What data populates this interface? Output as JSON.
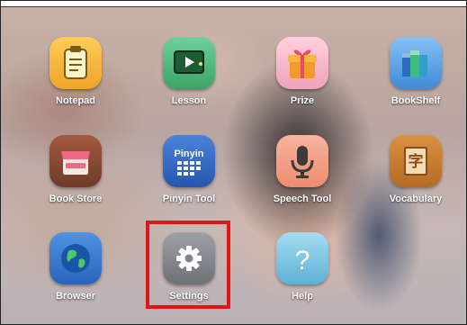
{
  "apps": [
    {
      "key": "notepad",
      "label": "Notepad",
      "icon": "notepad-icon",
      "color": "#f2b43a"
    },
    {
      "key": "lesson",
      "label": "Lesson",
      "icon": "lesson-board-icon",
      "color": "#4caf7a"
    },
    {
      "key": "prize",
      "label": "Prize",
      "icon": "gift-icon",
      "color": "#f4b3c6"
    },
    {
      "key": "bookshelf",
      "label": "BookShelf",
      "icon": "books-icon",
      "color": "#5ea3e6"
    },
    {
      "key": "bookstore",
      "label": "Book Store",
      "icon": "store-icon",
      "color": "#8a4b35"
    },
    {
      "key": "pinyin",
      "label": "Pinyin Tool",
      "icon": "keyboard-icon",
      "color": "#3a6cc8",
      "icon_text": "Pinyin"
    },
    {
      "key": "speech",
      "label": "Speech Tool",
      "icon": "microphone-icon",
      "color": "#f2a489"
    },
    {
      "key": "vocabulary",
      "label": "Vocabulary",
      "icon": "dictionary-icon",
      "color": "#c97c2c",
      "icon_text": "字"
    },
    {
      "key": "browser",
      "label": "Browser",
      "icon": "globe-icon",
      "color": "#3f7fd1"
    },
    {
      "key": "settings",
      "label": "Settings",
      "icon": "gear-icon",
      "color": "#8b8e93"
    },
    {
      "key": "help",
      "label": "Help",
      "icon": "question-icon",
      "color": "#7cc4e0",
      "icon_text": "?"
    }
  ],
  "selected": "settings"
}
